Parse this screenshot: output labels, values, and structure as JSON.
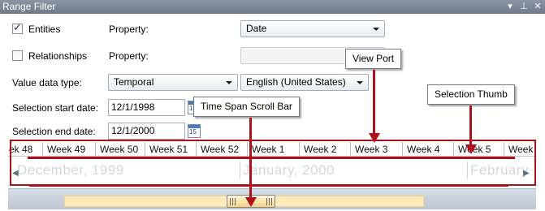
{
  "window": {
    "title": "Range Filter",
    "buttons": [
      "▾",
      "⊥",
      "✕"
    ]
  },
  "filters": {
    "entities": {
      "label": "Entities",
      "checked": true,
      "property_label": "Property:",
      "property_value": "Date"
    },
    "relationships": {
      "label": "Relationships",
      "checked": false,
      "property_label": "Property:",
      "property_value": ""
    },
    "value_data_type": {
      "label": "Value data type:",
      "type_value": "Temporal",
      "locale_value": "English (United States)"
    },
    "selection_start": {
      "label": "Selection start date:",
      "value": "12/1/1998"
    },
    "selection_end": {
      "label": "Selection end date:",
      "value": "12/1/2000"
    },
    "calendar_day": "15"
  },
  "timeline": {
    "weeks": [
      "ek 48",
      "Week 49",
      "Week 50",
      "Week 51",
      "Week 52",
      "Week 1",
      "Week 2",
      "Week 3",
      "Week 4",
      "Week 5",
      "Week"
    ],
    "months": [
      "December, 1999",
      "January, 2000",
      "February"
    ],
    "nav_left": "◀",
    "nav_right": "▶"
  },
  "callouts": {
    "view_port": "View Port",
    "selection_thumb": "Selection Thumb",
    "time_span_scroll_bar": "Time Span Scroll Bar"
  },
  "colors": {
    "annotation_red": "#b0101a",
    "titlebar": "#7b8694",
    "scroll_range": "#fdebb9"
  }
}
